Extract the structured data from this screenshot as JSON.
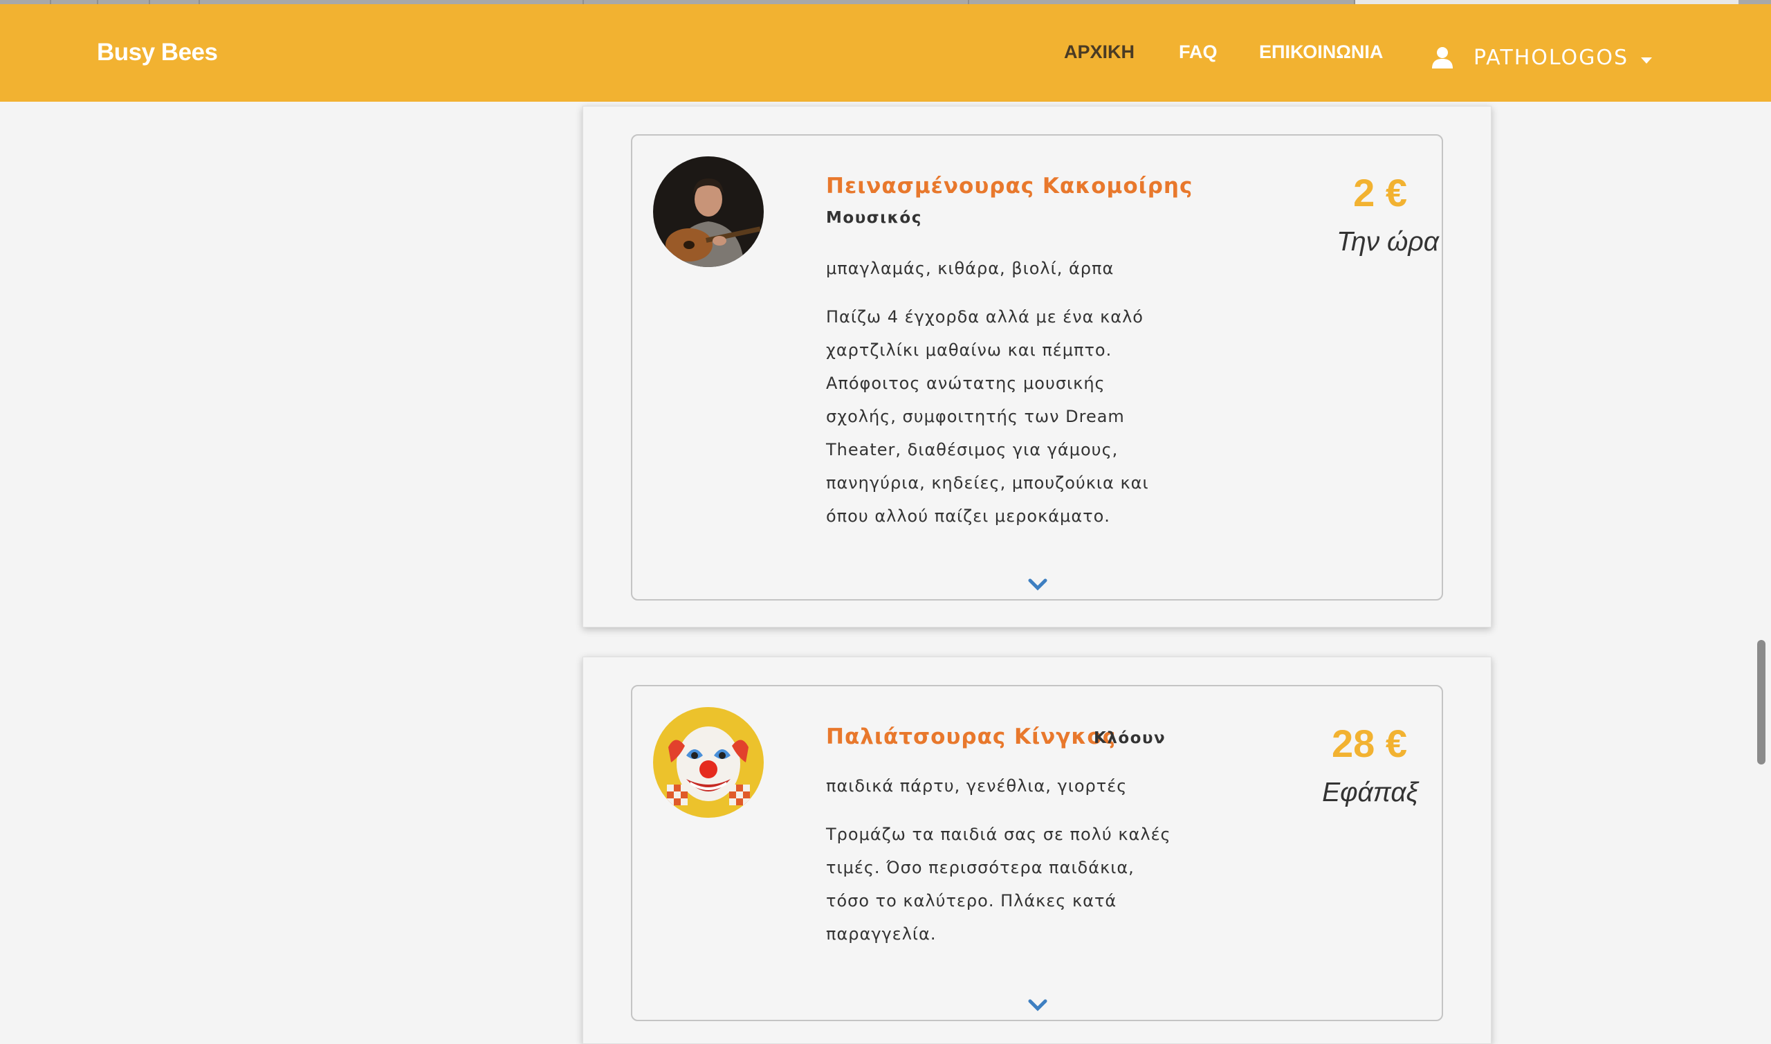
{
  "navbar": {
    "brand": "Busy Bees",
    "links": [
      {
        "label": "ΑΡΧΙΚΗ",
        "active": true
      },
      {
        "label": "FAQ",
        "active": false
      },
      {
        "label": "ΕΠΙΚΟΙΝΩΝΙΑ",
        "active": false
      }
    ],
    "user": {
      "icon": "user-icon",
      "label": "PATHOLOGOS"
    }
  },
  "profiles": [
    {
      "name": "Πεινασμένουρας Κακομοίρης",
      "role": "Μουσικός",
      "tags": "μπαγλαμάς, κιθάρα, βιολί, άρπα",
      "description_lines": [
        "Παίζω 4 έγχορδα αλλά με ένα καλό",
        "χαρτζιλίκι μαθαίνω και πέμπτο.",
        "Απόφοιτος ανώτατης μουσικής",
        "σχολής, συμφοιτητής των Dream",
        "Theater, διαθέσιμος για γάμους,",
        "πανηγύρια, κηδείες, μπουζούκια και",
        "όπου αλλού παίζει μεροκάματο."
      ],
      "price": "2 €",
      "price_unit": "Την ώρα",
      "avatar_icon": "guitarist-avatar"
    },
    {
      "name": "Παλιάτσουρας Κίνγκος",
      "role": "Κλόουν",
      "tags": "παιδικά πάρτυ, γενέθλια, γιορτές",
      "description_lines": [
        "Τρομάζω τα παιδιά σας σε πολύ καλές",
        "τιμές. Όσο περισσότερα παιδάκια,",
        "τόσο το καλύτερο. Πλάκες κατά",
        "παραγγελία."
      ],
      "price": "28 €",
      "price_unit": "Εφάπαξ",
      "avatar_icon": "clown-avatar"
    }
  ],
  "colors": {
    "navbar": "#f2b231",
    "name": "#e8782c",
    "price": "#f2b231",
    "chevron": "#3e7fc1"
  }
}
